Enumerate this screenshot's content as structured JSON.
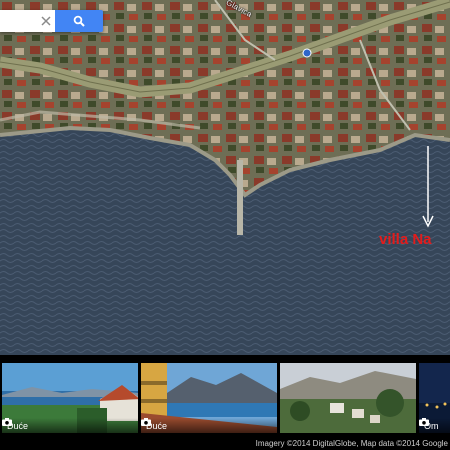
{
  "search": {
    "placeholder": "",
    "value": ""
  },
  "map": {
    "road_label": "Glavica",
    "marker_label": "villa Na",
    "marker_color": "#e41b1b",
    "road_color": "#9a9b74",
    "water_color": "#3a4a5e",
    "search_button_color": "#4285f4"
  },
  "photos": [
    {
      "label": "Duće"
    },
    {
      "label": "Duće"
    },
    {
      "label": ""
    },
    {
      "label": "Om"
    }
  ],
  "attribution": "Imagery ©2014 DigitalGlobe, Map data ©2014 Google"
}
